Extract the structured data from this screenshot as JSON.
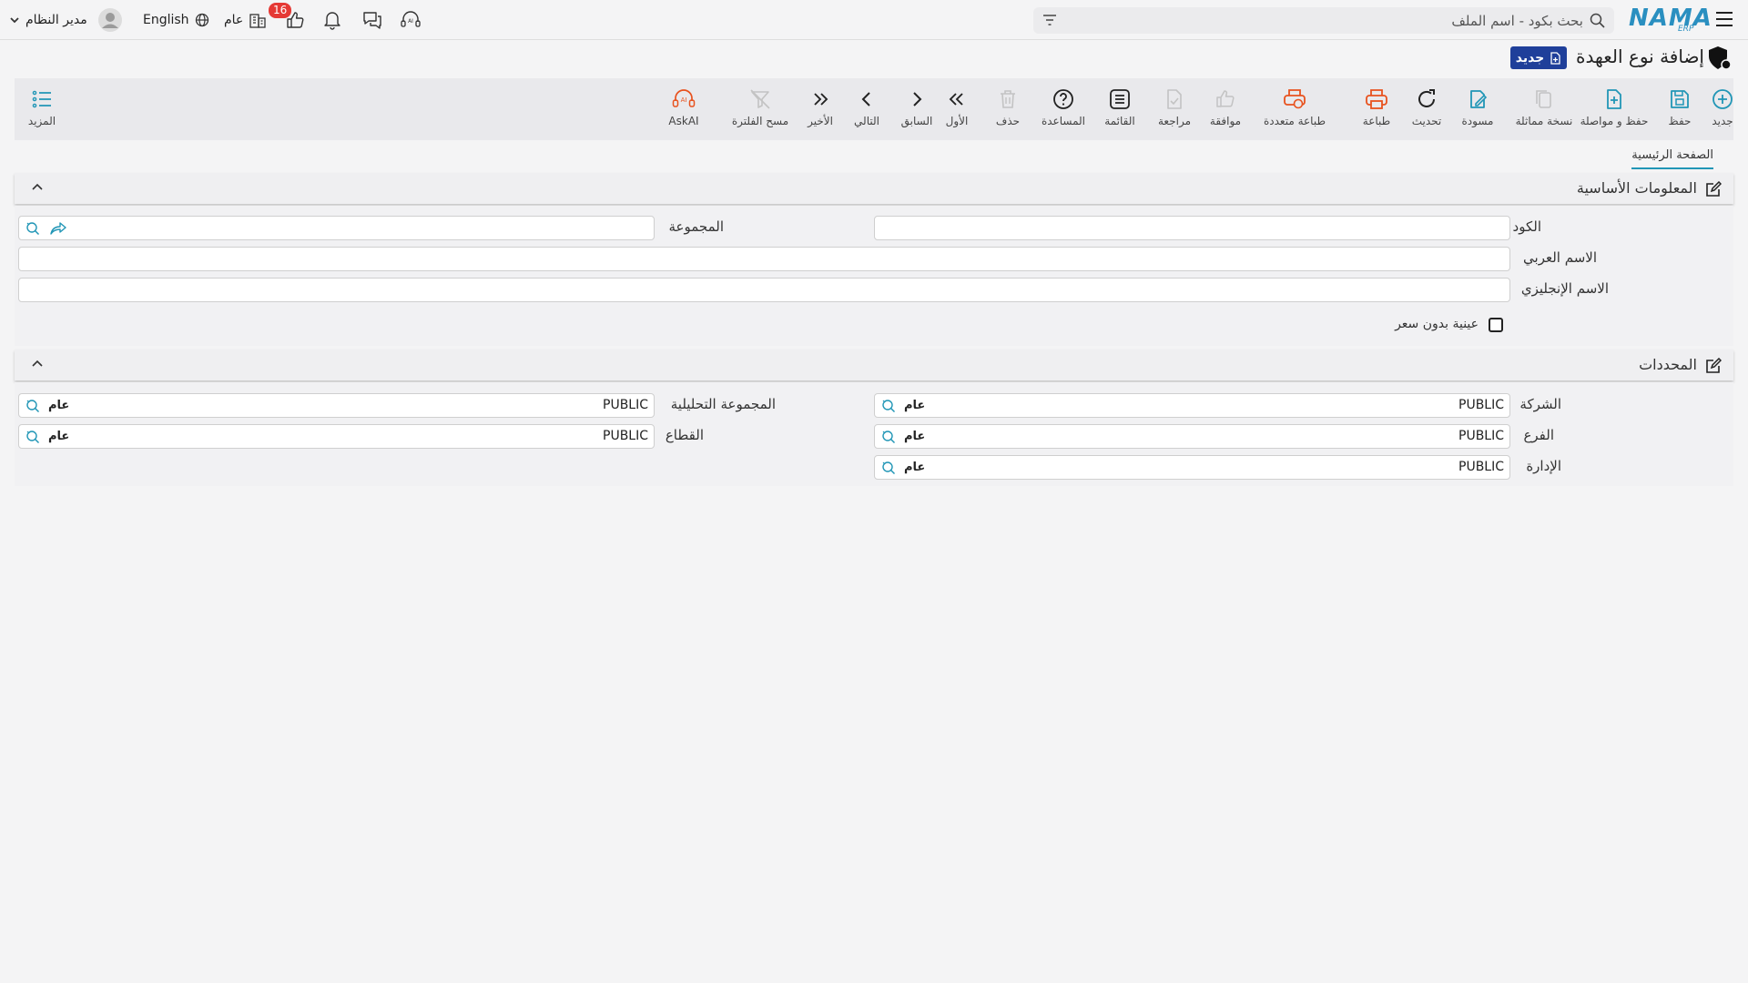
{
  "topbar": {
    "brand": "NAMA",
    "brand_sub": "ERP",
    "search_placeholder": "بحث بكود - اسم الملف",
    "user_name": "مدير النظام",
    "language": "English",
    "scope": "عام",
    "likes_count": "16"
  },
  "page": {
    "title": "إضافة نوع العهدة",
    "new_badge": "جديد"
  },
  "toolbar": {
    "new": "جديد",
    "save": "حفظ",
    "save_continue": "حفظ و مواصلة",
    "clone": "نسخة مماثلة",
    "draft": "مسودة",
    "refresh": "تحديث",
    "print": "طباعة",
    "multi_print": "طباعة متعددة",
    "approve": "موافقة",
    "review": "مراجعة",
    "list": "القائمة",
    "help": "المساعدة",
    "delete": "حذف",
    "first": "الأول",
    "previous": "السابق",
    "next": "التالي",
    "last": "الأخير",
    "clear_filter": "مسح الفلترة",
    "askai": "AskAI",
    "more": "المزيد"
  },
  "tabs": {
    "main": "الصفحة الرئيسية"
  },
  "basic": {
    "title": "المعلومات الأساسية",
    "code_label": "الكود",
    "code_value": "",
    "group_label": "المجموعة",
    "group_value": "",
    "arabic_name_label": "الاسم العربي",
    "arabic_name_value": "",
    "english_name_label": "الاسم الإنجليزي",
    "english_name_value": "",
    "no_price_sample_label": "عينية بدون سعر",
    "no_price_sample_checked": false
  },
  "dimensions": {
    "title": "المحددات",
    "company_label": "الشركة",
    "company_value": "PUBLIC",
    "company_tag": "عام",
    "analytic_group_label": "المجموعة التحليلية",
    "analytic_group_value": "PUBLIC",
    "analytic_group_tag": "عام",
    "branch_label": "الفرع",
    "branch_value": "PUBLIC",
    "branch_tag": "عام",
    "sector_label": "القطاع",
    "sector_value": "PUBLIC",
    "sector_tag": "عام",
    "department_label": "الإدارة",
    "department_value": "PUBLIC",
    "department_tag": "عام"
  },
  "colors": {
    "accent": "#2196b6",
    "print_orange": "#e8521e",
    "new_badge_bg": "#1f3f9a",
    "notification_red": "#e53935"
  }
}
